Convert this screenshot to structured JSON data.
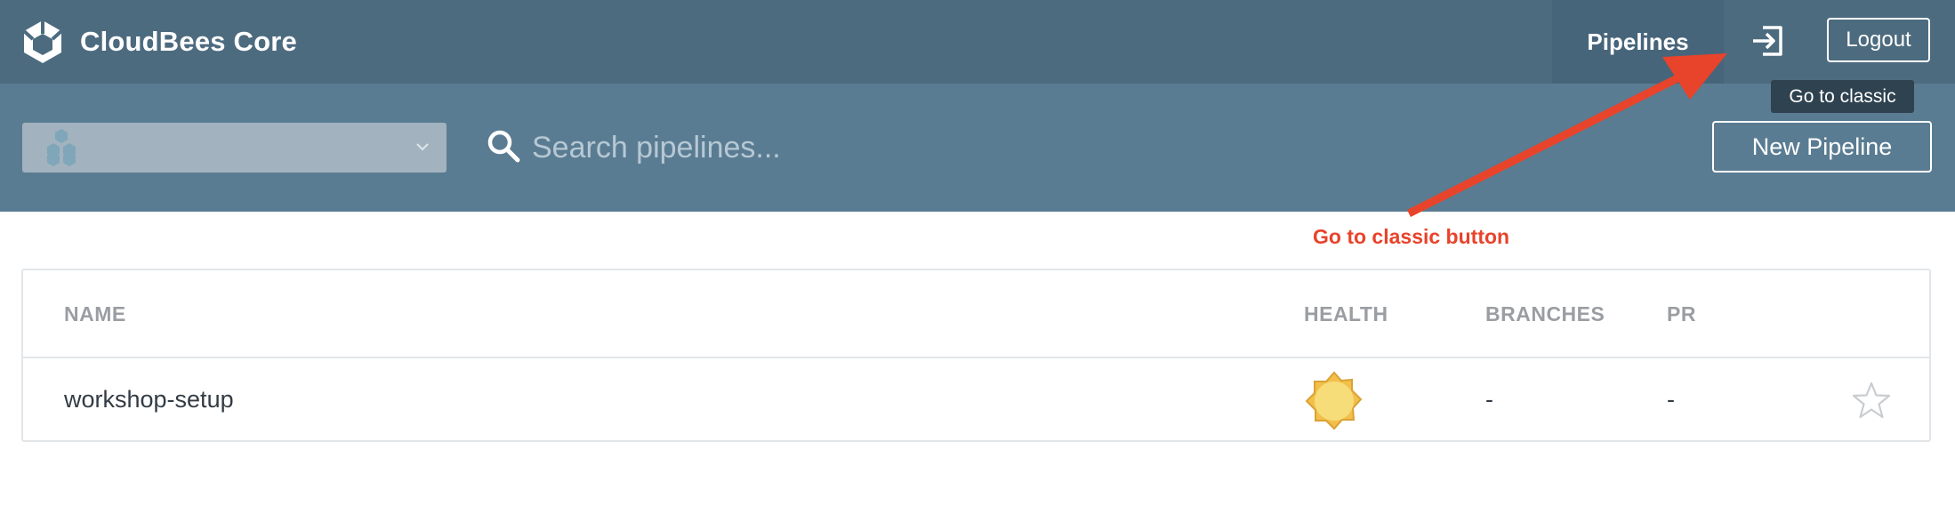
{
  "brand": {
    "name": "CloudBees Core",
    "logo_icon": "cloudbees-hexagon-icon"
  },
  "nav": {
    "active": "Pipelines",
    "pipelines_label": "Pipelines"
  },
  "header": {
    "classic_icon": "go-to-classic-icon",
    "logout_label": "Logout",
    "tooltip": "Go to classic"
  },
  "toolbar": {
    "org_selector_value": "",
    "org_icon": "hexagon-cluster-icon",
    "search_placeholder": "Search pipelines...",
    "new_pipeline_label": "New Pipeline"
  },
  "table": {
    "columns": {
      "name": "NAME",
      "health": "HEALTH",
      "branches": "BRANCHES",
      "pr": "PR"
    },
    "rows": [
      {
        "name": "workshop-setup",
        "health_icon": "sunny-weather-icon",
        "branches": "-",
        "pr": "-",
        "favorite": false
      }
    ]
  },
  "annotation": {
    "label": "Go to classic button",
    "color": "#e8432b"
  },
  "colors": {
    "header_bg": "#4d6b7f",
    "subheader_bg": "#5a7c92",
    "accent": "#e8432b"
  }
}
